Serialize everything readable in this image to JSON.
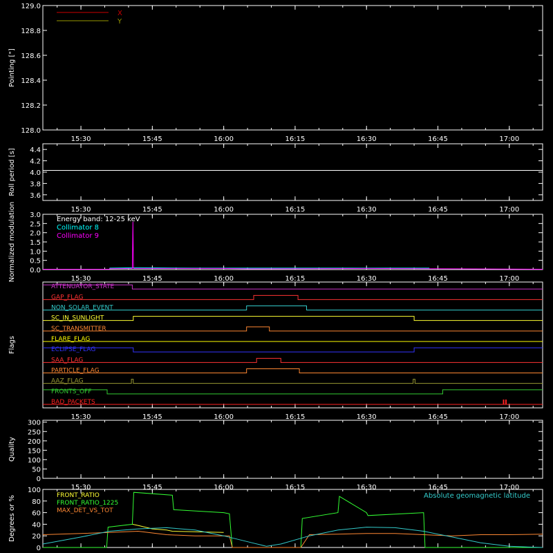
{
  "time_ticks": [
    "15:30",
    "15:45",
    "16:00",
    "16:15",
    "16:30",
    "16:45",
    "17:00"
  ],
  "time_tick_hours": [
    15.5,
    15.75,
    16.0,
    16.25,
    16.5,
    16.75,
    17.0
  ],
  "x_range_hours": [
    15.3667,
    17.1167
  ],
  "chart_data": [
    {
      "type": "line",
      "ylabel": "Pointing [\"]",
      "ylim": [
        128.0,
        129.0
      ],
      "yticks": [
        "128.0",
        "128.2",
        "128.4",
        "128.6",
        "128.8",
        "129.0"
      ],
      "ytick_values": [
        128.0,
        128.2,
        128.4,
        128.6,
        128.8,
        129.0
      ],
      "legend": "top-left",
      "series": [
        {
          "name": "X",
          "color": "#cc0000",
          "x": [],
          "y": []
        },
        {
          "name": "Y",
          "color": "#999900",
          "x": [],
          "y": []
        }
      ]
    },
    {
      "type": "line",
      "ylabel": "Roll period [s]",
      "ylim": [
        3.5,
        4.5
      ],
      "yticks": [
        "3.6",
        "3.8",
        "4.0",
        "4.2",
        "4.4"
      ],
      "ytick_values": [
        3.6,
        3.8,
        4.0,
        4.2,
        4.4
      ],
      "series": [
        {
          "color": "#ffffff",
          "x": [
            15.3667,
            15.5,
            15.75,
            16.0,
            16.25,
            16.5,
            16.75,
            17.1167
          ],
          "y": [
            4.03,
            4.03,
            4.03,
            4.03,
            4.03,
            4.03,
            4.03,
            4.03
          ]
        }
      ]
    },
    {
      "type": "line",
      "ylabel": "Normalized modulation",
      "ylim": [
        0.0,
        3.0
      ],
      "yticks": [
        "0.0",
        "0.5",
        "1.0",
        "1.5",
        "2.0",
        "2.5",
        "3.0"
      ],
      "ytick_values": [
        0.0,
        0.5,
        1.0,
        1.5,
        2.0,
        2.5,
        3.0
      ],
      "annotation": "Energy band: 12-25 keV",
      "legend": "top-left",
      "series": [
        {
          "name": "Collimator 8",
          "color": "#00ffff",
          "x": [
            15.6,
            15.7,
            15.8,
            15.9,
            16.0,
            16.08,
            16.28,
            16.4,
            16.5,
            16.6,
            16.72
          ],
          "y": [
            0.08,
            0.1,
            0.09,
            0.08,
            0.08,
            0.08,
            0.08,
            0.08,
            0.08,
            0.08,
            0.08
          ]
        },
        {
          "name": "Collimator 9",
          "color": "#ff00ff",
          "x": [
            15.3667,
            15.599,
            15.6,
            15.68,
            15.682,
            15.684,
            15.8,
            16.0,
            16.08,
            16.28,
            16.5,
            16.72,
            17.1167
          ],
          "y": [
            0.02,
            0.02,
            0.05,
            0.06,
            2.6,
            0.06,
            0.06,
            0.06,
            0.04,
            0.05,
            0.06,
            0.05,
            0.02
          ]
        }
      ]
    },
    {
      "type": "line",
      "ylabel": "Flags",
      "flags": [
        {
          "name": "ATTENUATOR_STATE",
          "color": "#cc33cc",
          "steps": [
            [
              15.3667,
              1
            ],
            [
              15.68,
              0
            ],
            [
              17.1167,
              0
            ]
          ]
        },
        {
          "name": "GAP_FLAG",
          "color": "#ff3333",
          "steps": [
            [
              15.3667,
              0
            ],
            [
              16.105,
              1
            ],
            [
              16.26,
              0
            ],
            [
              17.1167,
              0
            ]
          ]
        },
        {
          "name": "NON_SOLAR_EVENT",
          "color": "#33cccc",
          "steps": [
            [
              15.3667,
              0
            ],
            [
              16.08,
              1
            ],
            [
              16.29,
              0
            ],
            [
              17.1167,
              0
            ]
          ]
        },
        {
          "name": "SC_IN_SUNLIGHT",
          "color": "#ffff33",
          "steps": [
            [
              15.3667,
              0
            ],
            [
              15.6833,
              1
            ],
            [
              16.6667,
              0
            ],
            [
              17.1167,
              0
            ]
          ]
        },
        {
          "name": "SC_TRANSMITTER",
          "color": "#ff8833",
          "steps": [
            [
              15.3667,
              0
            ],
            [
              16.08,
              1
            ],
            [
              16.16,
              0
            ],
            [
              17.1167,
              0
            ]
          ]
        },
        {
          "name": "FLARE_FLAG",
          "color": "#ffff00",
          "steps": [
            [
              15.3667,
              0
            ],
            [
              17.1167,
              0
            ]
          ]
        },
        {
          "name": "ECLIPSE_FLAG",
          "color": "#3333ff",
          "steps": [
            [
              15.3667,
              1
            ],
            [
              15.6833,
              0
            ],
            [
              16.6667,
              1
            ],
            [
              17.1167,
              1
            ]
          ]
        },
        {
          "name": "SAA_FLAG",
          "color": "#ff3333",
          "steps": [
            [
              15.3667,
              0
            ],
            [
              16.115,
              1
            ],
            [
              16.2,
              0
            ],
            [
              17.1167,
              0
            ]
          ]
        },
        {
          "name": "PARTICLE_FLAG",
          "color": "#ff8833",
          "steps": [
            [
              15.3667,
              0
            ],
            [
              16.08,
              1
            ],
            [
              16.265,
              0
            ],
            [
              17.1167,
              0
            ]
          ]
        },
        {
          "name": "AAZ_FLAG",
          "color": "#999933",
          "steps": [
            [
              15.3667,
              0
            ],
            [
              15.6767,
              1
            ],
            [
              15.6833,
              0
            ],
            [
              16.6633,
              1
            ],
            [
              16.67,
              0
            ],
            [
              17.1167,
              0
            ]
          ]
        },
        {
          "name": "FRONTS_OFF",
          "color": "#33cc33",
          "steps": [
            [
              15.3667,
              1
            ],
            [
              15.5917,
              0
            ],
            [
              16.7667,
              1
            ],
            [
              17.1167,
              1
            ]
          ]
        },
        {
          "name": "BAD_PACKETS",
          "color": "#ff2222",
          "spikes": [
            16.98,
            16.9883
          ]
        }
      ]
    },
    {
      "type": "line",
      "ylabel": "Quality",
      "ylim": [
        0,
        310
      ],
      "yticks": [
        "0",
        "50",
        "100",
        "150",
        "200",
        "250",
        "300"
      ],
      "ytick_values": [
        0,
        50,
        100,
        150,
        200,
        250,
        300
      ],
      "series": []
    },
    {
      "type": "line",
      "ylabel": "Degrees or %",
      "ylim": [
        0,
        100
      ],
      "yticks": [
        "0",
        "20",
        "40",
        "60",
        "80",
        "100"
      ],
      "ytick_values": [
        0,
        20,
        40,
        60,
        80,
        100
      ],
      "legend": "top-left",
      "series": [
        {
          "name": "FRONT_RATIO",
          "color": "#ffff33",
          "x": [
            15.68,
            15.7,
            15.75,
            15.8,
            15.82,
            16.0
          ],
          "y": [
            40,
            38,
            32,
            30,
            28,
            26
          ]
        },
        {
          "name": "FRONT_RATIO_1225",
          "color": "#33ff33",
          "x": [
            15.3667,
            15.59,
            15.595,
            15.68,
            15.685,
            15.82,
            15.825,
            16.0,
            16.02,
            16.03,
            16.27,
            16.275,
            16.4,
            16.405,
            16.5,
            16.505,
            16.7,
            16.705,
            17.1167
          ],
          "y": [
            0,
            0,
            35,
            40,
            95,
            90,
            65,
            60,
            58,
            0,
            0,
            50,
            60,
            88,
            60,
            55,
            60,
            0,
            0
          ]
        },
        {
          "name": "MAX_DET_VS_TOT",
          "color": "#ff8833",
          "x": [
            15.3667,
            15.5,
            15.6,
            15.7,
            15.8,
            15.9,
            16.0,
            16.02,
            16.03,
            16.27,
            16.3,
            16.4,
            16.5,
            16.6,
            16.7,
            16.8,
            16.9,
            17.0,
            17.1167
          ],
          "y": [
            22,
            24,
            26,
            28,
            22,
            20,
            20,
            20,
            0,
            0,
            22,
            23,
            24,
            24,
            22,
            20,
            22,
            22,
            23
          ]
        },
        {
          "name": "Absolute geomagnetic latitude",
          "color": "#33cccc",
          "x": [
            15.3667,
            15.5,
            15.6,
            15.7,
            15.8,
            15.9,
            16.0,
            16.1,
            16.15,
            16.2,
            16.3,
            16.4,
            16.5,
            16.6,
            16.7,
            16.8,
            16.9,
            17.0,
            17.1167
          ],
          "y": [
            6,
            18,
            28,
            32,
            34,
            30,
            20,
            8,
            2,
            6,
            20,
            30,
            35,
            34,
            28,
            18,
            8,
            2,
            0
          ]
        }
      ]
    }
  ]
}
